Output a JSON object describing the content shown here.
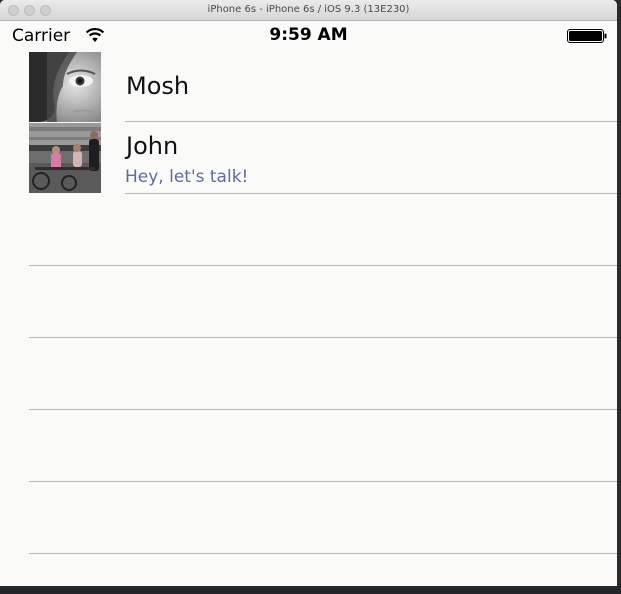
{
  "window": {
    "title": "iPhone 6s - iPhone 6s / iOS 9.3 (13E230)"
  },
  "status_bar": {
    "carrier": "Carrier",
    "time": "9:59 AM",
    "wifi_icon": "wifi-icon",
    "battery_icon": "battery-icon"
  },
  "contacts": [
    {
      "name": "Mosh",
      "subtitle": "",
      "avatar": "portrait-photo"
    },
    {
      "name": "John",
      "subtitle": "Hey, let's talk!",
      "avatar": "street-scene-photo"
    }
  ],
  "colors": {
    "subtitle": "#5b6d9a",
    "separator": "#b8b8b8",
    "background": "#fafaf9"
  }
}
